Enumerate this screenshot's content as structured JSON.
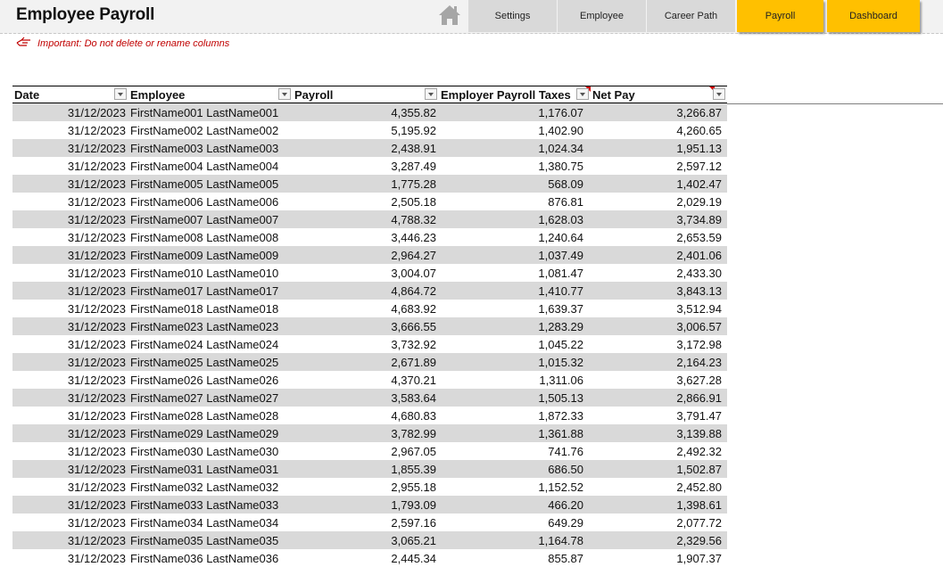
{
  "app": {
    "title": "Employee Payroll"
  },
  "nav": {
    "home_icon": "home-icon",
    "buttons": [
      {
        "label": "Settings",
        "active": false
      },
      {
        "label": "Employee",
        "active": false
      },
      {
        "label": "Career Path",
        "active": false
      },
      {
        "label": "Payroll",
        "active": true
      },
      {
        "label": "Dashboard",
        "active": true
      }
    ]
  },
  "note": {
    "icon": "pointing-hand-icon",
    "text": "Important: Do not delete or rename columns"
  },
  "colors": {
    "accent": "#ffc000",
    "nav_bg": "#d9d9d9",
    "band": "#d9d9d9",
    "note": "#c00000"
  },
  "table": {
    "columns": [
      "Date",
      "Employee",
      "Payroll",
      "Employer Payroll Taxes",
      "Net Pay"
    ],
    "rows": [
      [
        "31/12/2023",
        "FirstName001  LastName001",
        "4,355.82",
        "1,176.07",
        "3,266.87"
      ],
      [
        "31/12/2023",
        "FirstName002  LastName002",
        "5,195.92",
        "1,402.90",
        "4,260.65"
      ],
      [
        "31/12/2023",
        "FirstName003  LastName003",
        "2,438.91",
        "1,024.34",
        "1,951.13"
      ],
      [
        "31/12/2023",
        "FirstName004  LastName004",
        "3,287.49",
        "1,380.75",
        "2,597.12"
      ],
      [
        "31/12/2023",
        "FirstName005  LastName005",
        "1,775.28",
        "568.09",
        "1,402.47"
      ],
      [
        "31/12/2023",
        "FirstName006  LastName006",
        "2,505.18",
        "876.81",
        "2,029.19"
      ],
      [
        "31/12/2023",
        "FirstName007  LastName007",
        "4,788.32",
        "1,628.03",
        "3,734.89"
      ],
      [
        "31/12/2023",
        "FirstName008  LastName008",
        "3,446.23",
        "1,240.64",
        "2,653.59"
      ],
      [
        "31/12/2023",
        "FirstName009  LastName009",
        "2,964.27",
        "1,037.49",
        "2,401.06"
      ],
      [
        "31/12/2023",
        "FirstName010  LastName010",
        "3,004.07",
        "1,081.47",
        "2,433.30"
      ],
      [
        "31/12/2023",
        "FirstName017  LastName017",
        "4,864.72",
        "1,410.77",
        "3,843.13"
      ],
      [
        "31/12/2023",
        "FirstName018  LastName018",
        "4,683.92",
        "1,639.37",
        "3,512.94"
      ],
      [
        "31/12/2023",
        "FirstName023  LastName023",
        "3,666.55",
        "1,283.29",
        "3,006.57"
      ],
      [
        "31/12/2023",
        "FirstName024  LastName024",
        "3,732.92",
        "1,045.22",
        "3,172.98"
      ],
      [
        "31/12/2023",
        "FirstName025  LastName025",
        "2,671.89",
        "1,015.32",
        "2,164.23"
      ],
      [
        "31/12/2023",
        "FirstName026  LastName026",
        "4,370.21",
        "1,311.06",
        "3,627.28"
      ],
      [
        "31/12/2023",
        "FirstName027  LastName027",
        "3,583.64",
        "1,505.13",
        "2,866.91"
      ],
      [
        "31/12/2023",
        "FirstName028  LastName028",
        "4,680.83",
        "1,872.33",
        "3,791.47"
      ],
      [
        "31/12/2023",
        "FirstName029  LastName029",
        "3,782.99",
        "1,361.88",
        "3,139.88"
      ],
      [
        "31/12/2023",
        "FirstName030  LastName030",
        "2,967.05",
        "741.76",
        "2,492.32"
      ],
      [
        "31/12/2023",
        "FirstName031  LastName031",
        "1,855.39",
        "686.50",
        "1,502.87"
      ],
      [
        "31/12/2023",
        "FirstName032  LastName032",
        "2,955.18",
        "1,152.52",
        "2,452.80"
      ],
      [
        "31/12/2023",
        "FirstName033  LastName033",
        "1,793.09",
        "466.20",
        "1,398.61"
      ],
      [
        "31/12/2023",
        "FirstName034  LastName034",
        "2,597.16",
        "649.29",
        "2,077.72"
      ],
      [
        "31/12/2023",
        "FirstName035  LastName035",
        "3,065.21",
        "1,164.78",
        "2,329.56"
      ],
      [
        "31/12/2023",
        "FirstName036  LastName036",
        "2,445.34",
        "855.87",
        "1,907.37"
      ]
    ]
  }
}
